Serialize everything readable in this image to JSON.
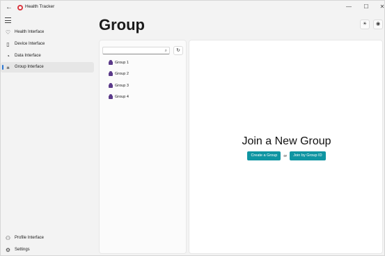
{
  "window": {
    "app_title": "Health Tracker",
    "back_icon": "back-arrow-icon",
    "minimize_glyph": "—",
    "maximize_glyph": "☐",
    "close_glyph": "✕"
  },
  "sidebar": {
    "items": [
      {
        "label": "Health Interface",
        "icon": "heart-icon",
        "glyph": "♡",
        "active": false
      },
      {
        "label": "Device Interface",
        "icon": "device-icon",
        "glyph": "▯",
        "active": false
      },
      {
        "label": "Data Interface",
        "icon": "data-icon",
        "glyph": "◔",
        "active": false
      },
      {
        "label": "Group Interface",
        "icon": "group-network-icon",
        "glyph": "⚹",
        "active": true
      }
    ],
    "footer_items": [
      {
        "label": "Profile Interface",
        "icon": "people-icon",
        "glyph": "⚇"
      },
      {
        "label": "Settings",
        "icon": "gear-icon",
        "glyph": "⚙"
      }
    ]
  },
  "header": {
    "title": "Group",
    "theme_glyph": "☀",
    "github_glyph": "◉"
  },
  "group_list": {
    "search_placeholder": "",
    "search_glyph": "⌕",
    "refresh_glyph": "↻",
    "groups": [
      "Group 1",
      "Group 2",
      "Group 3",
      "Group 4"
    ]
  },
  "main": {
    "heading": "Join a New Group",
    "create_button": "Create a Group",
    "or_text": "or",
    "join_button": "Join by Group ID"
  },
  "colors": {
    "accent": "#0f95a2",
    "nav_indicator": "#2b76d2",
    "group_icon": "#5b3a8a",
    "logo": "#d9363e"
  }
}
